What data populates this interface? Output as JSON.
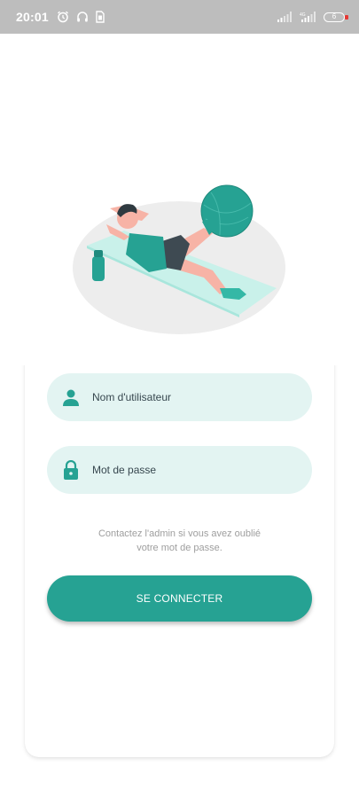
{
  "status_bar": {
    "time": "20:01",
    "battery_level": "6",
    "icons": [
      "alarm-icon",
      "headphones-icon",
      "sim-icon",
      "wifi-icon",
      "signal-icon",
      "battery-icon"
    ]
  },
  "illustration": {
    "description_icon": "workout-illustration",
    "colors": {
      "accent": "#26a293",
      "light": "#c9f1ea",
      "ground": "#ededed"
    }
  },
  "login_form": {
    "username_placeholder": "Nom d'utilisateur",
    "password_placeholder": "Mot de passe",
    "hint_line1": "Contactez l'admin si vous avez oublié",
    "hint_line2": "votre mot de passe.",
    "submit_label": "SE CONNECTER"
  },
  "colors": {
    "primary": "#26a293",
    "field_background": "#e3f4f2",
    "hint_text": "#9e9e9e",
    "status_bar": "#bdbdbd"
  }
}
